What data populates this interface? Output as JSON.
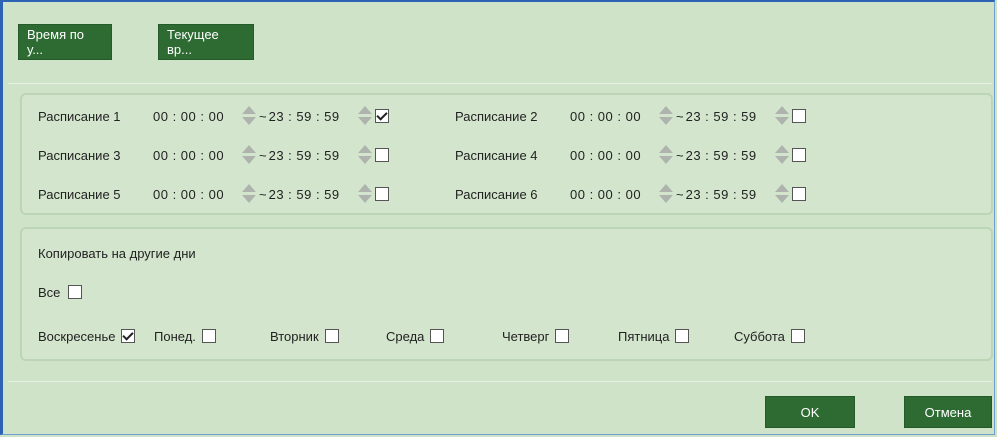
{
  "toolbar": {
    "time_by_default_label": "Время по у...",
    "current_time_label": "Текущее вр..."
  },
  "schedules": [
    {
      "label": "Расписание 1",
      "start": "00 : 00 : 00",
      "end": "23 : 59 : 59",
      "checked": true
    },
    {
      "label": "Расписание 2",
      "start": "00 : 00 : 00",
      "end": "23 : 59 : 59",
      "checked": false
    },
    {
      "label": "Расписание 3",
      "start": "00 : 00 : 00",
      "end": "23 : 59 : 59",
      "checked": false
    },
    {
      "label": "Расписание 4",
      "start": "00 : 00 : 00",
      "end": "23 : 59 : 59",
      "checked": false
    },
    {
      "label": "Расписание 5",
      "start": "00 : 00 : 00",
      "end": "23 : 59 : 59",
      "checked": false
    },
    {
      "label": "Расписание 6",
      "start": "00 : 00 : 00",
      "end": "23 : 59 : 59",
      "checked": false
    }
  ],
  "range_separator": "~",
  "copy": {
    "title": "Копировать на другие дни",
    "all_label": "Все",
    "all_checked": false,
    "days": [
      {
        "label": "Воскресенье",
        "checked": true
      },
      {
        "label": "Понед.",
        "checked": false
      },
      {
        "label": "Вторник",
        "checked": false
      },
      {
        "label": "Среда",
        "checked": false
      },
      {
        "label": "Четверг",
        "checked": false
      },
      {
        "label": "Пятница",
        "checked": false
      },
      {
        "label": "Суббота",
        "checked": false
      }
    ]
  },
  "footer": {
    "ok_label": "OK",
    "cancel_label": "Отмена"
  },
  "colors": {
    "background": "#cfe3c9",
    "button": "#2e6b33"
  }
}
